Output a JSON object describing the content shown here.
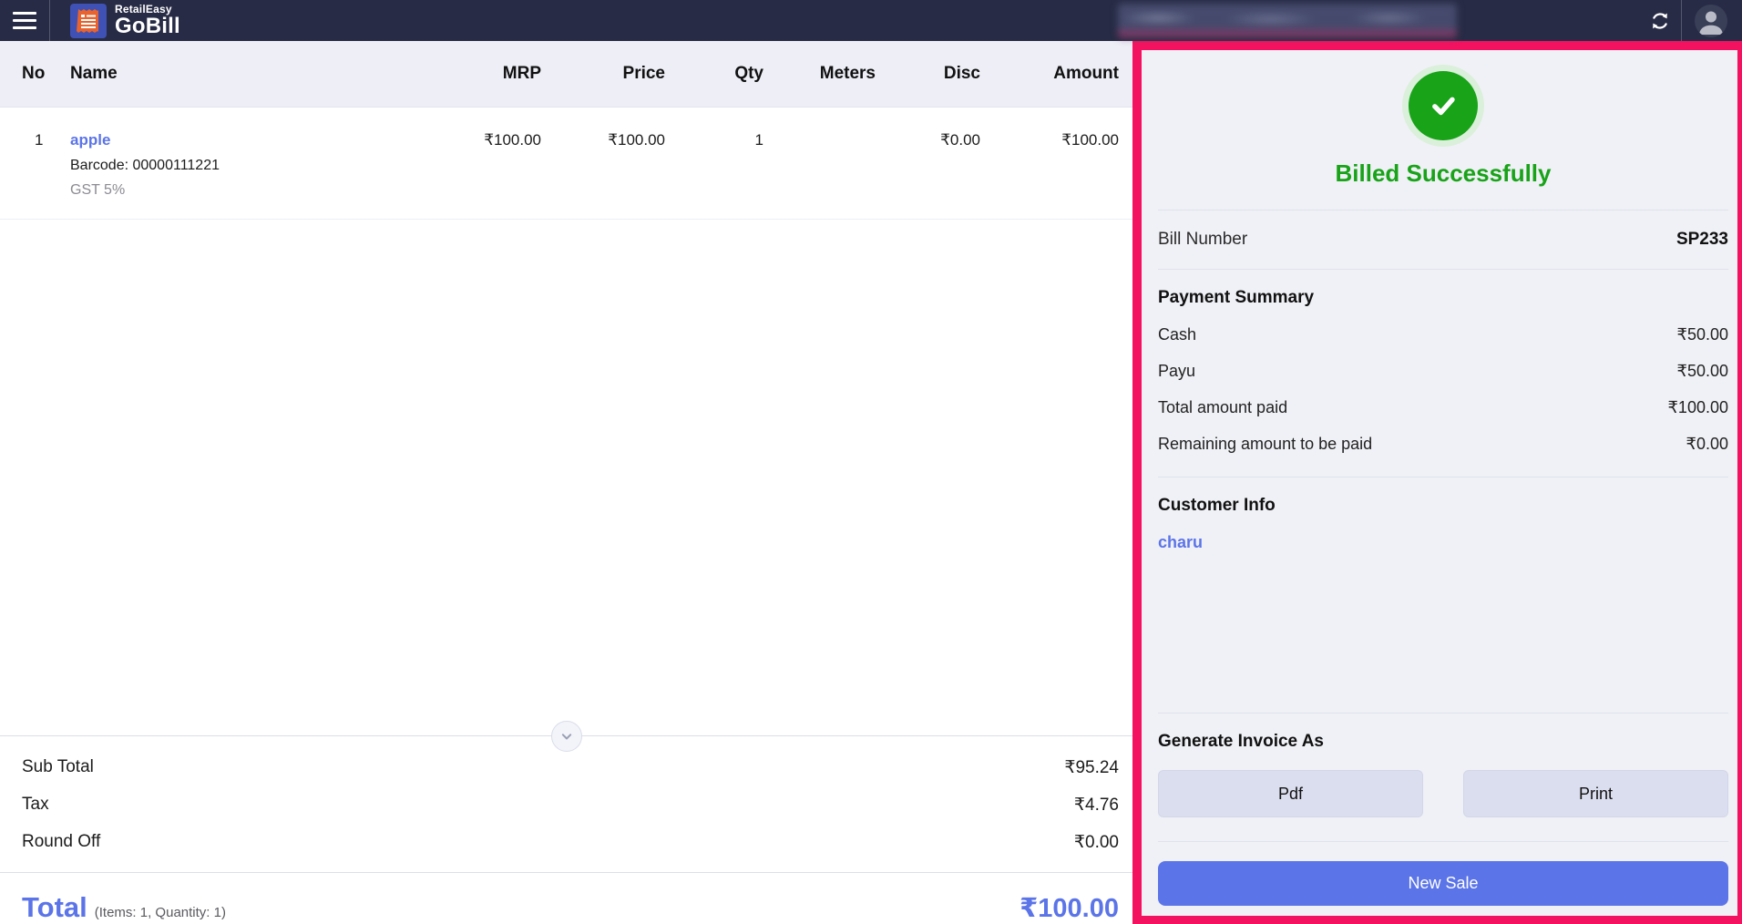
{
  "brand": {
    "top": "RetailEasy",
    "bottom": "GoBill"
  },
  "table": {
    "columns": [
      "No",
      "Name",
      "MRP",
      "Price",
      "Qty",
      "Meters",
      "Disc",
      "Amount"
    ],
    "rows": [
      {
        "no": "1",
        "name": "apple",
        "barcode": "Barcode: 00000111221",
        "tax": "GST 5%",
        "mrp": "₹100.00",
        "price": "₹100.00",
        "qty": "1",
        "meters": "",
        "disc": "₹0.00",
        "amount": "₹100.00"
      }
    ]
  },
  "totals": {
    "rows": [
      {
        "label": "Sub Total",
        "value": "₹95.24"
      },
      {
        "label": "Tax",
        "value": "₹4.76"
      },
      {
        "label": "Round Off",
        "value": "₹0.00"
      }
    ],
    "total_label": "Total",
    "total_meta": "(Items: 1, Quantity: 1)",
    "total_value": "₹100.00"
  },
  "panel": {
    "success_title": "Billed Successfully",
    "bill_number_label": "Bill Number",
    "bill_number_value": "SP233",
    "payment": {
      "heading": "Payment Summary",
      "rows": [
        {
          "label": "Cash",
          "value": "₹50.00"
        },
        {
          "label": "Payu",
          "value": "₹50.00"
        },
        {
          "label": "Total amount paid",
          "value": "₹100.00"
        },
        {
          "label": "Remaining amount to be paid",
          "value": "₹0.00"
        }
      ]
    },
    "customer": {
      "heading": "Customer Info",
      "name": "charu"
    },
    "invoice": {
      "heading": "Generate Invoice As",
      "pdf_label": "Pdf",
      "print_label": "Print"
    },
    "new_sale_label": "New Sale"
  },
  "colors": {
    "topbar": "#272b45",
    "accent_blue": "#5b74e8",
    "success_green": "#18a318",
    "highlight_border": "#f31260",
    "panel_bg": "#f0f1f6",
    "header_bg": "#edeef6"
  }
}
